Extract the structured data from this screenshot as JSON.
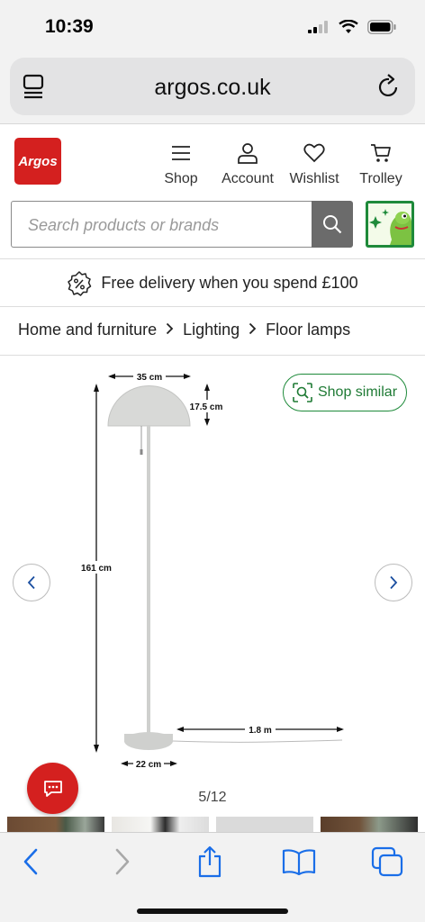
{
  "status_bar": {
    "time": "10:39"
  },
  "browser": {
    "url": "argos.co.uk"
  },
  "header": {
    "logo_text": "Argos",
    "nav": [
      {
        "label": "Shop",
        "icon": "menu-icon"
      },
      {
        "label": "Account",
        "icon": "user-icon"
      },
      {
        "label": "Wishlist",
        "icon": "heart-icon"
      },
      {
        "label": "Trolley",
        "icon": "cart-icon"
      }
    ],
    "search": {
      "placeholder": "Search products or brands"
    }
  },
  "delivery_banner": {
    "text": "Free delivery when you spend £100"
  },
  "breadcrumb": [
    "Home and furniture",
    "Lighting",
    "Floor lamps"
  ],
  "gallery": {
    "shop_similar_label": "Shop similar",
    "counter": "5/12",
    "dimensions": {
      "shade_width": "35 cm",
      "shade_height": "17.5 cm",
      "total_height": "161 cm",
      "base_width": "22 cm",
      "cable_length": "1.8 m"
    }
  },
  "colors": {
    "brand_red": "#d4201f",
    "accent_green": "#1e8a3a",
    "ios_blue": "#1a6ee8"
  }
}
